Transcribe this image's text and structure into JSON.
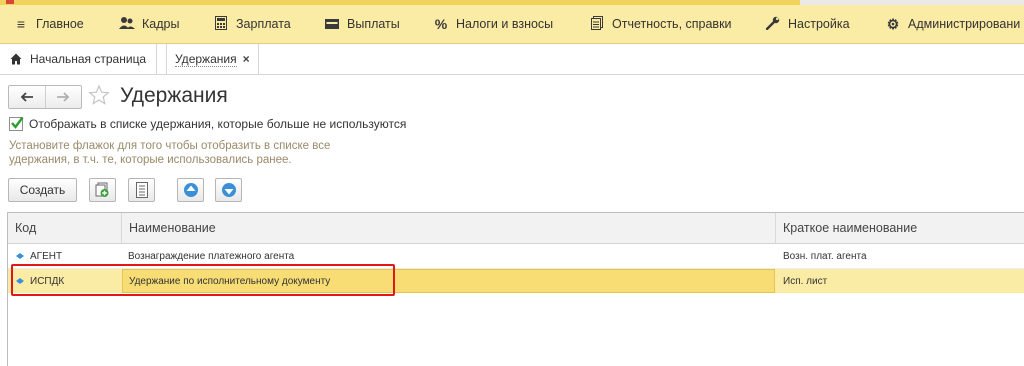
{
  "menu": [
    {
      "icon": "hamburger-icon",
      "label": "Главное"
    },
    {
      "icon": "people-icon",
      "label": "Кадры"
    },
    {
      "icon": "calculator-icon",
      "label": "Зарплата"
    },
    {
      "icon": "wallet-icon",
      "label": "Выплаты"
    },
    {
      "icon": "percent-icon",
      "label": "Налоги и взносы"
    },
    {
      "icon": "report-icon",
      "label": "Отчетность, справки"
    },
    {
      "icon": "wrench-icon",
      "label": "Настройка"
    },
    {
      "icon": "gear-icon",
      "label": "Администрировани"
    }
  ],
  "tabs": {
    "home": "Начальная страница",
    "active": "Удержания",
    "close": "×"
  },
  "page": {
    "title": "Удержания",
    "checkbox_label": "Отображать в списке удержания, которые больше не используются",
    "checkbox_checked": true,
    "hint": "Установите флажок для того чтобы отобразить в списке все удержания, в т.ч. те, которые использовались ранее."
  },
  "toolbar": {
    "create_label": "Создать",
    "icons": [
      "copy-add-icon",
      "list-icon",
      "move-up-icon",
      "move-down-icon"
    ]
  },
  "table": {
    "headers": {
      "code": "Код",
      "name": "Наименование",
      "short": "Краткое наименование"
    },
    "rows": [
      {
        "code": "АГЕНТ",
        "name": "Вознаграждение платежного агента",
        "short": "Возн. плат. агента"
      },
      {
        "code": "ИСПДК",
        "name": "Удержание по исполнительному документу",
        "short": "Исп. лист",
        "selected": true
      }
    ]
  },
  "colors": {
    "menubar": "#fbeca5",
    "selected_row": "#fbeca5",
    "highlight_border": "#e01818",
    "accent_blue": "#3b8fd6"
  }
}
